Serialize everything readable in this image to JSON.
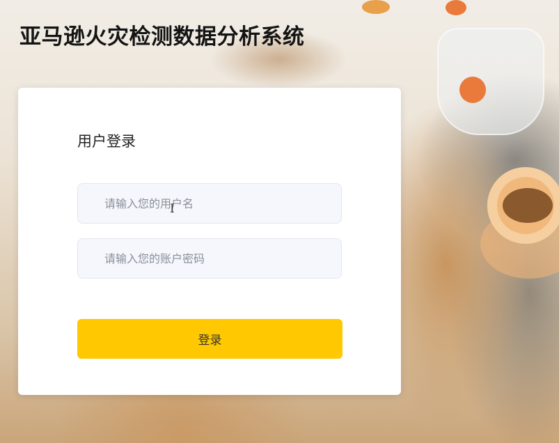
{
  "app": {
    "title": "亚马逊火灾检测数据分析系统"
  },
  "login": {
    "heading": "用户登录",
    "username": {
      "value": "",
      "placeholder": "请输入您的用户名"
    },
    "password": {
      "value": "",
      "placeholder": "请输入您的账户密码"
    },
    "submit_label": "登录"
  },
  "colors": {
    "accent": "#ffc800",
    "card": "#ffffff",
    "input_bg": "#f5f7fc"
  },
  "icons": {
    "cursor": "text-cursor-icon"
  }
}
